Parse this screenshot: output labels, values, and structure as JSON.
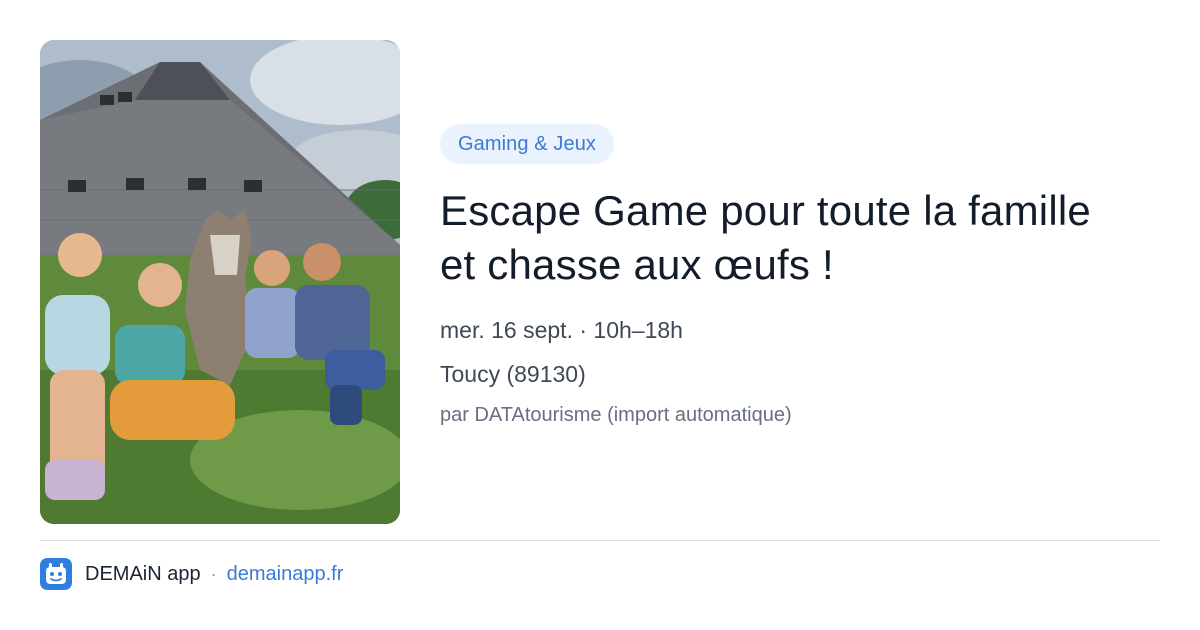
{
  "event": {
    "category": "Gaming & Jeux",
    "title_line1": "Escape Game pour toute la famille",
    "title_line2": "et chasse aux œufs !",
    "date_time": "mer. 16 sept. · 10h–18h",
    "location": "Toucy (89130)",
    "source": "par DATAtourisme (import automatique)"
  },
  "footer": {
    "app_name": "DEMAiN app",
    "separator": "·",
    "url": "demainapp.fr"
  },
  "colors": {
    "accent": "#3c7ad9",
    "chip_background": "#eaf2fd",
    "title": "#131c2b",
    "divider": "#dbe1e7"
  },
  "icons": {
    "app_logo": "demain-logo-icon"
  }
}
